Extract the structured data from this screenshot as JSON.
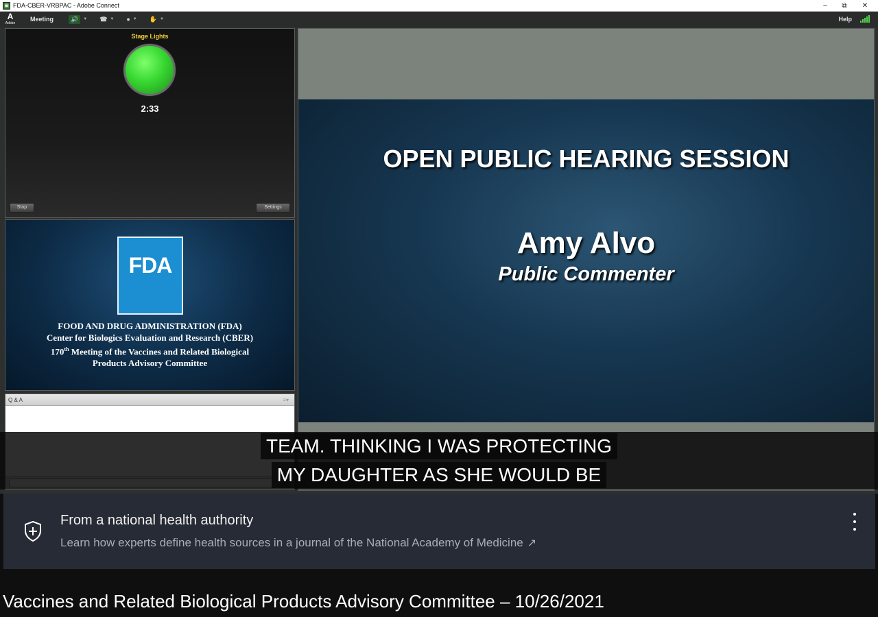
{
  "window": {
    "title": "FDA-CBER-VRBPAC - Adobe Connect",
    "minimize": "–",
    "restore": "⧉",
    "close": "✕"
  },
  "menubar": {
    "adobe_glyph": "A",
    "adobe_label": "Adobe",
    "meeting": "Meeting",
    "help": "Help",
    "speaker_glyph": "🔊",
    "phone_glyph": "☎",
    "camera_glyph": "●",
    "hand_glyph": "✋",
    "caret": "▼"
  },
  "stage_lights": {
    "title": "Stage Lights",
    "timer": "2:33",
    "stop_label": "Stop",
    "settings_label": "Settings",
    "light_color": "#39d832"
  },
  "fda_pod": {
    "logo_text": "FDA",
    "line1": "FOOD AND DRUG ADMINISTRATION (FDA)",
    "line2": "Center for Biologics Evaluation and Research (CBER)",
    "line3_num": "170",
    "line3_sup": "th",
    "line3_rest": " Meeting of the Vaccines and Related Biological",
    "line4": "Products Advisory Committee"
  },
  "qa_pod": {
    "title": "Q & A",
    "menu_glyph": "≡▾",
    "send_glyph": "▸"
  },
  "slide": {
    "heading": "OPEN PUBLIC HEARING SESSION",
    "name": "Amy Alvo",
    "role": "Public Commenter"
  },
  "captions": {
    "line1": "TEAM. THINKING I WAS PROTECTING",
    "line2": "MY DAUGHTER AS SHE WOULD BE"
  },
  "info_panel": {
    "heading": "From a national health authority",
    "sub": "Learn how experts define health sources in a journal of the National Academy of Medicine",
    "ext_glyph": "↗"
  },
  "video_title": "Vaccines and Related Biological Products Advisory Committee – 10/26/2021",
  "colors": {
    "accent_green": "#52d552",
    "fda_blue": "#1b8fd1",
    "panel_bg": "#272b35"
  }
}
